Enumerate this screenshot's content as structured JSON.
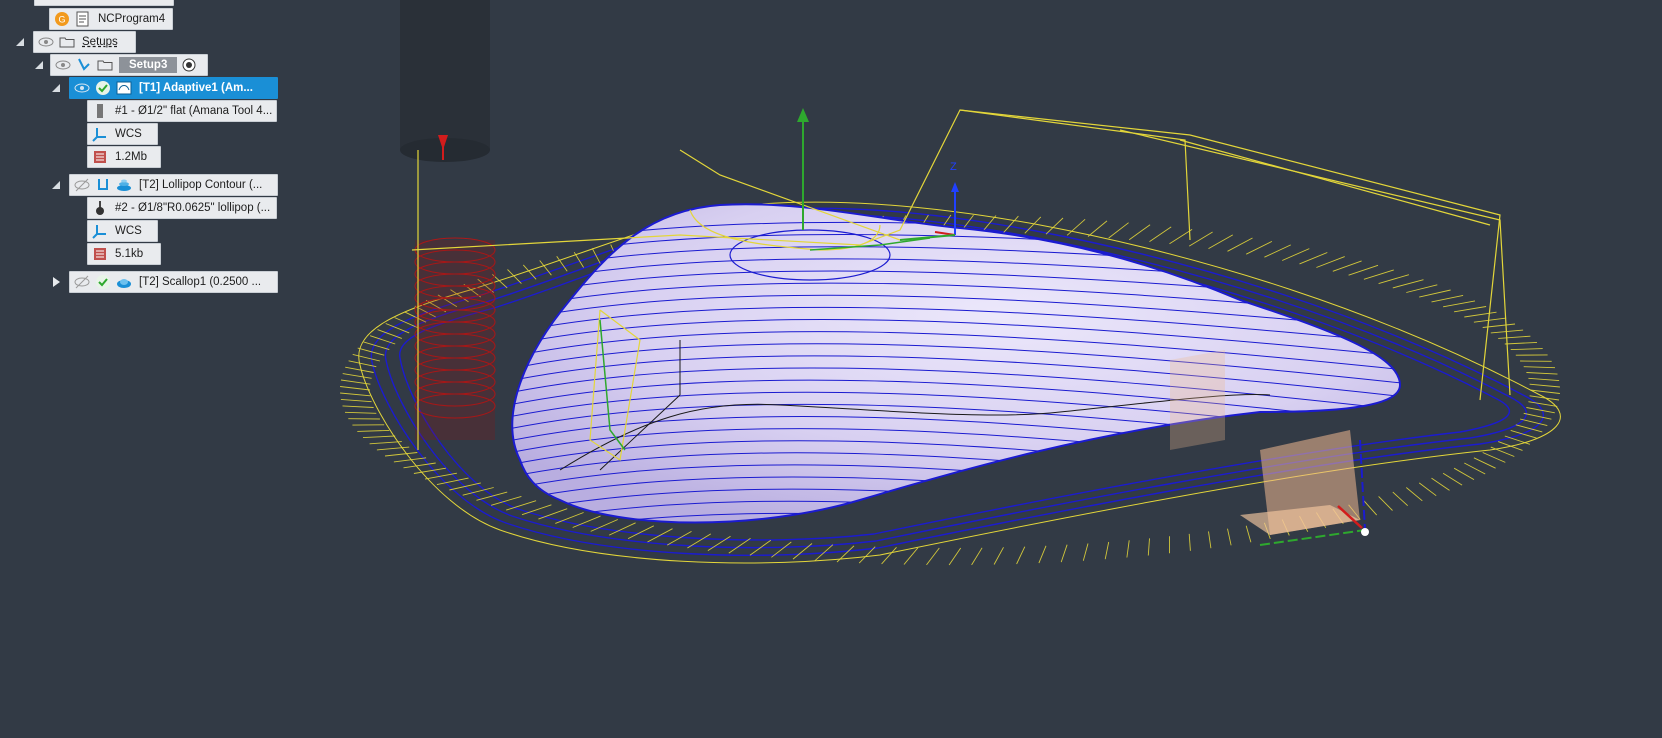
{
  "browser": {
    "nodes": {
      "ncprogram": {
        "label": "NCProgram4"
      },
      "setups": {
        "label": "Setups"
      },
      "setup3": {
        "label": "Setup3"
      },
      "adaptive": {
        "label": "[T1] Adaptive1 (Am..."
      },
      "tool1": {
        "label": "#1 - Ø1/2\" flat (Amana Tool 4..."
      },
      "wcs1": {
        "label": "WCS"
      },
      "size1": {
        "label": "1.2Mb"
      },
      "lollipop": {
        "label": "[T2] Lollipop Contour (..."
      },
      "tool2": {
        "label": "#2 - Ø1/8\"R0.0625\" lollipop (..."
      },
      "wcs2": {
        "label": "WCS"
      },
      "size2": {
        "label": "5.1kb"
      },
      "scallop": {
        "label": "[T2] Scallop1 (0.2500 ..."
      }
    }
  },
  "viewport": {
    "axis_label": "Z",
    "colors": {
      "background": "#323a45",
      "part_surface": "#ded8f4",
      "contour": "#1b1bd0",
      "rapid": "#e3d63a",
      "lead": "#2ea82e",
      "tool": "#2a3038",
      "stock": "#f0b890"
    }
  }
}
